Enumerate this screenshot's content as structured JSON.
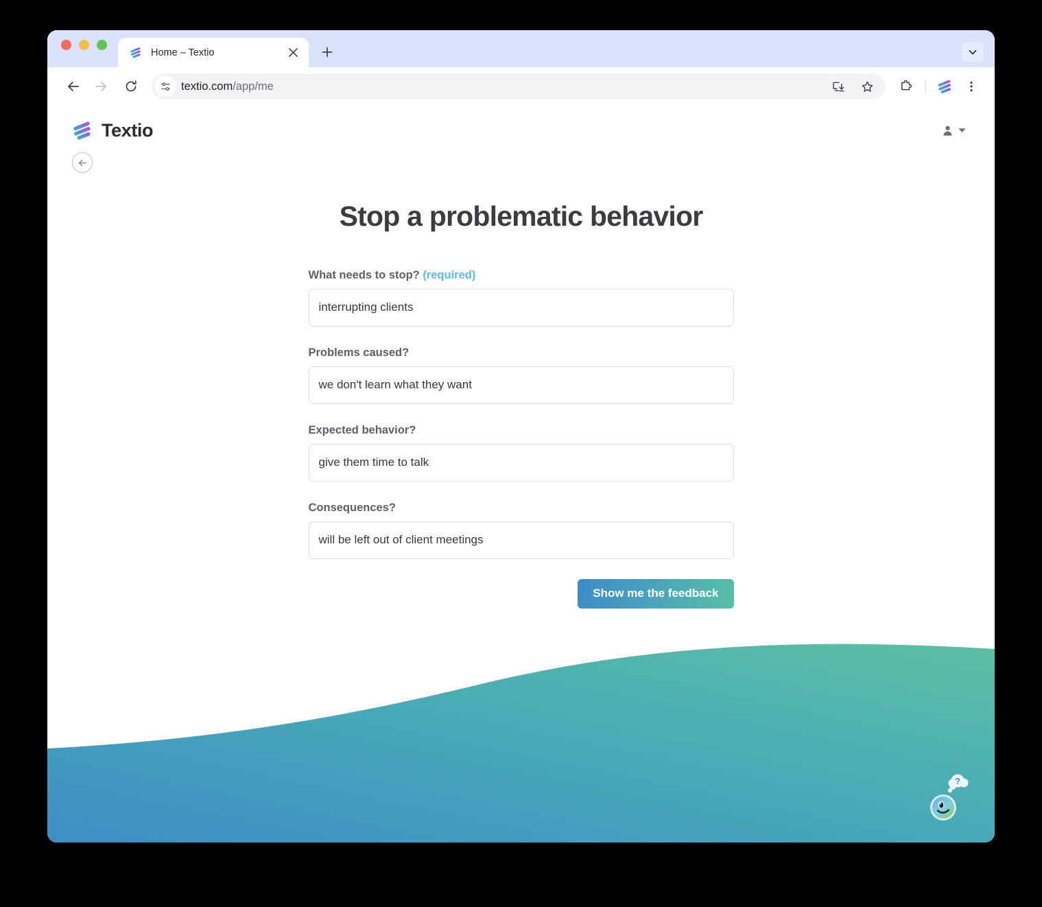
{
  "browser": {
    "tab": {
      "title": "Home – Textio",
      "favicon_icon": "textio-logo-icon",
      "close_icon": "close-icon"
    },
    "new_tab_icon": "plus-icon",
    "tab_search_icon": "chevron-down-icon",
    "nav": {
      "back_icon": "arrow-left-icon",
      "forward_icon": "arrow-right-icon",
      "reload_icon": "reload-icon"
    },
    "omnibox": {
      "site_settings_icon": "tune-icon",
      "url_domain": "textio.com",
      "url_path": "/app/me",
      "install_icon": "install-app-icon",
      "bookmark_icon": "star-icon"
    },
    "toolbar_right": {
      "extensions_icon": "puzzle-piece-icon",
      "extension_textio_icon": "textio-extension-icon",
      "menu_icon": "three-dots-vertical-icon"
    },
    "traffic_lights": {
      "close": "#ef6b5d",
      "minimize": "#f3bc45",
      "zoom": "#61c454"
    }
  },
  "site": {
    "brand_name": "Textio",
    "brand_logo_icon": "textio-logo-icon",
    "account_icon": "user-avatar-icon",
    "account_caret_icon": "caret-down-icon",
    "back_button_icon": "arrow-left-circle-icon"
  },
  "form": {
    "title": "Stop a problematic behavior",
    "fields": [
      {
        "label": "What needs to stop?",
        "required_tag": "(required)",
        "value": "interrupting clients"
      },
      {
        "label": "Problems caused?",
        "required_tag": "",
        "value": "we don't learn what they want"
      },
      {
        "label": "Expected behavior?",
        "required_tag": "",
        "value": "give them time to talk"
      },
      {
        "label": "Consequences?",
        "required_tag": "",
        "value": "will be left out of client meetings"
      }
    ],
    "submit_label": "Show me the feedback"
  },
  "help": {
    "icon": "help-face-icon",
    "bubble_text": "?"
  },
  "colors": {
    "accent_required": "#58bdee",
    "button_gradient_start": "#3c8cc6",
    "button_gradient_end": "#58bfa4",
    "wave_start": "#3d8ec5",
    "wave_end": "#5cc0a4",
    "tab_strip": "#d9e1fb"
  }
}
